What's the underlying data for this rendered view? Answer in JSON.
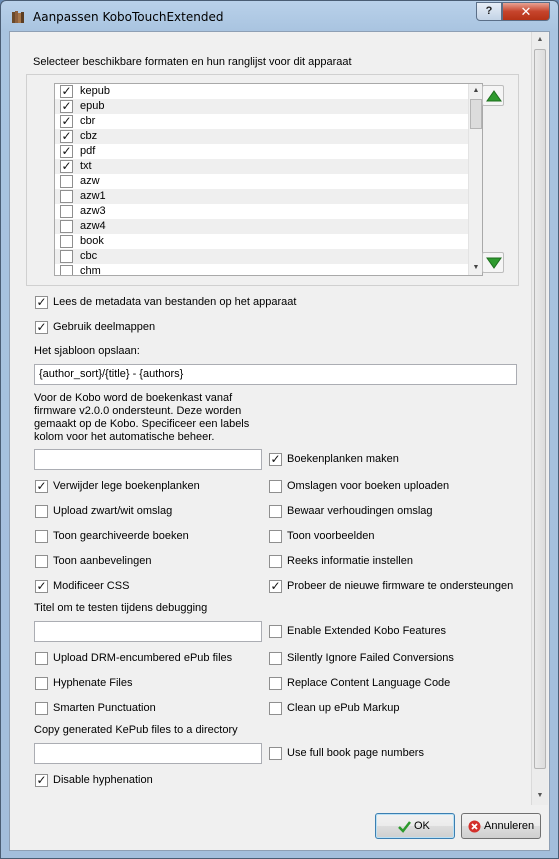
{
  "window": {
    "title": "Aanpassen KoboTouchExtended",
    "help_label": "?",
    "close_label": "✕"
  },
  "formats": {
    "heading": "Selecteer beschikbare formaten en hun ranglijst voor dit apparaat",
    "items": [
      {
        "label": "kepub",
        "checked": true
      },
      {
        "label": "epub",
        "checked": true
      },
      {
        "label": "cbr",
        "checked": true
      },
      {
        "label": "cbz",
        "checked": true
      },
      {
        "label": "pdf",
        "checked": true
      },
      {
        "label": "txt",
        "checked": true
      },
      {
        "label": "azw",
        "checked": false
      },
      {
        "label": "azw1",
        "checked": false
      },
      {
        "label": "azw3",
        "checked": false
      },
      {
        "label": "azw4",
        "checked": false
      },
      {
        "label": "book",
        "checked": false
      },
      {
        "label": "cbc",
        "checked": false
      },
      {
        "label": "chm",
        "checked": false
      }
    ]
  },
  "options": {
    "read_metadata": "Lees de metadata van bestanden op het apparaat",
    "use_subdirs": "Gebruik deelmappen",
    "save_template_label": "Het sjabloon opslaan:",
    "save_template_value": "{author_sort}/{title} - {authors}",
    "shelves_info": [
      "Voor de Kobo word de boekenkast vanaf",
      "firmware v2.0.0 ondersteunt. Deze worden",
      "gemaakt op de Kobo. Specificeer een labels",
      "kolom voor het automatische beheer."
    ],
    "shelves_column_value": "",
    "manage_shelves": "Boekenplanken maken",
    "delete_empty_shelves": "Verwijder lege boekenplanken",
    "upload_covers": "Omslagen voor boeken uploaden",
    "upload_grayscale": "Upload zwart/wit omslag",
    "keep_aspect": "Bewaar verhoudingen omslag",
    "show_archived": "Toon gearchiveerde boeken",
    "show_previews": "Toon voorbeelden",
    "show_recommendations": "Toon aanbevelingen",
    "set_series": "Reeks informatie instellen",
    "modify_css": "Modificeer CSS",
    "support_newer_firmware": "Probeer de nieuwe firmware te ondersteungen",
    "debug_title_label": "Titel om te testen tijdens debugging",
    "debug_title_value": "",
    "extended_features": "Enable Extended Kobo Features",
    "upload_drm": "Upload DRM-encumbered ePub files",
    "ignore_failed": "Silently Ignore Failed Conversions",
    "hyphenate": "Hyphenate Files",
    "replace_lang": "Replace Content Language Code",
    "smarten_punct": "Smarten Punctuation",
    "clean_markup": "Clean up ePub Markup",
    "copy_kepub_label": "Copy generated KePub files to a directory",
    "copy_kepub_value": "",
    "full_page_numbers": "Use full book page numbers",
    "disable_hyphenation": "Disable hyphenation"
  },
  "checked": {
    "read_metadata": true,
    "use_subdirs": true,
    "manage_shelves": true,
    "delete_empty_shelves": true,
    "upload_covers": false,
    "upload_grayscale": false,
    "keep_aspect": false,
    "show_archived": false,
    "show_previews": false,
    "show_recommendations": false,
    "set_series": false,
    "modify_css": true,
    "support_newer_firmware": true,
    "extended_features": false,
    "upload_drm": false,
    "ignore_failed": false,
    "hyphenate": false,
    "replace_lang": false,
    "smarten_punct": false,
    "clean_markup": false,
    "full_page_numbers": false,
    "disable_hyphenation": true
  },
  "buttons": {
    "ok": "OK",
    "cancel": "Annuleren"
  },
  "colors": {
    "accent_green": "#2e9a2e",
    "cancel_red": "#d3302b"
  }
}
